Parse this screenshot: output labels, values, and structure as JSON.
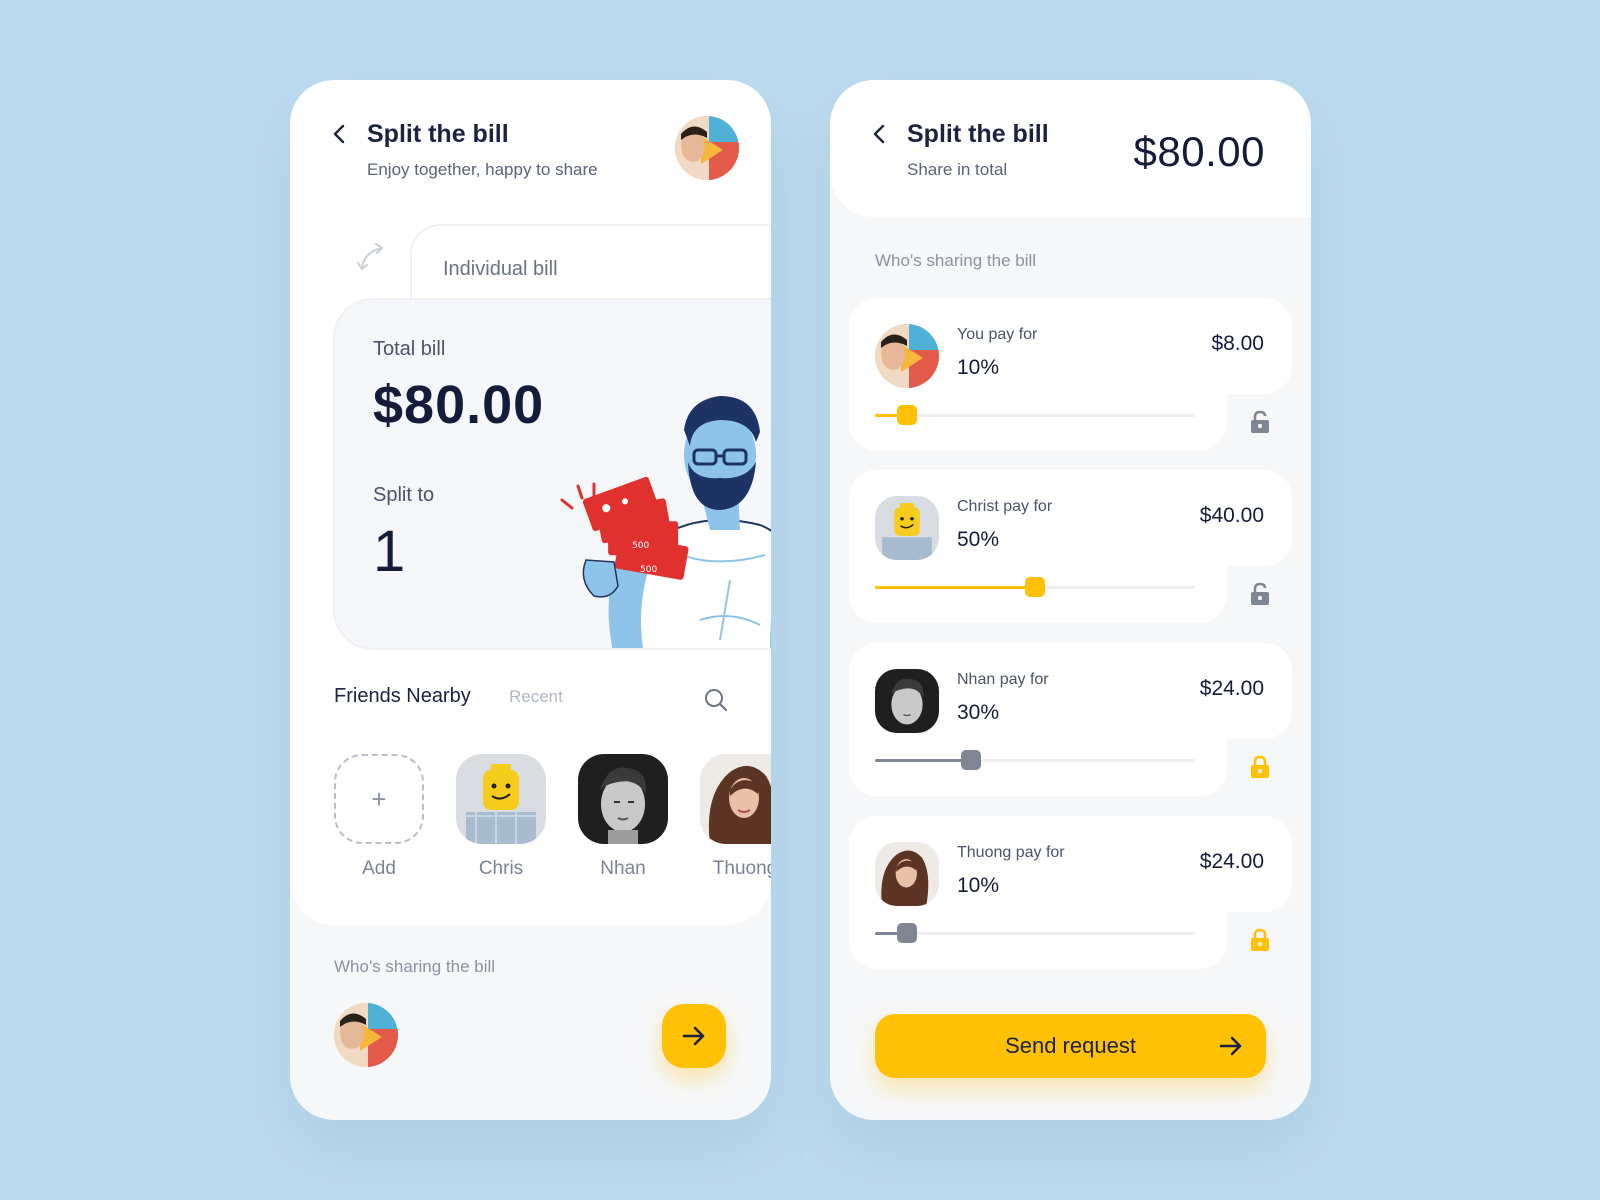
{
  "left": {
    "title": "Split the bill",
    "subtitle": "Enjoy together, happy to share",
    "tab_label": "Individual bill",
    "total_label": "Total bill",
    "total_value": "$80.00",
    "split_label": "Split to",
    "split_value": "1",
    "friends_tab": "Friends Nearby",
    "recent_tab": "Recent",
    "add_label": "Add",
    "friends": [
      {
        "name": "Chris"
      },
      {
        "name": "Nhan"
      },
      {
        "name": "Thuong"
      }
    ],
    "sharing_label": "Who's sharing the bill",
    "illustration_note_values": [
      "500",
      "500"
    ]
  },
  "right": {
    "title": "Split the bill",
    "subtitle": "Share in total",
    "total": "$80.00",
    "sharing_label": "Who's sharing the bill",
    "people": [
      {
        "label": "You pay for",
        "percent": "10%",
        "amount": "$8.00",
        "slider_value": 0.1,
        "locked": false,
        "accent": "#ffc106"
      },
      {
        "label": "Christ pay for",
        "percent": "50%",
        "amount": "$40.00",
        "slider_value": 0.5,
        "locked": false,
        "accent": "#ffc106"
      },
      {
        "label": "Nhan pay for",
        "percent": "30%",
        "amount": "$24.00",
        "slider_value": 0.3,
        "locked": true,
        "accent": "#7e8594"
      },
      {
        "label": "Thuong pay for",
        "percent": "10%",
        "amount": "$24.00",
        "slider_value": 0.1,
        "locked": true,
        "accent": "#7e8594"
      }
    ],
    "send_label": "Send request"
  },
  "colors": {
    "background": "#bcdaef",
    "accent": "#ffc106",
    "text_dark": "#141c3a",
    "muted": "#8a92a3",
    "locked": "#ffc106",
    "unlocked": "#7e8594"
  },
  "icons": [
    "back-chevron-icon",
    "swap-icon",
    "search-icon",
    "plus-icon",
    "arrow-right-icon",
    "lock-icon",
    "unlock-icon"
  ]
}
